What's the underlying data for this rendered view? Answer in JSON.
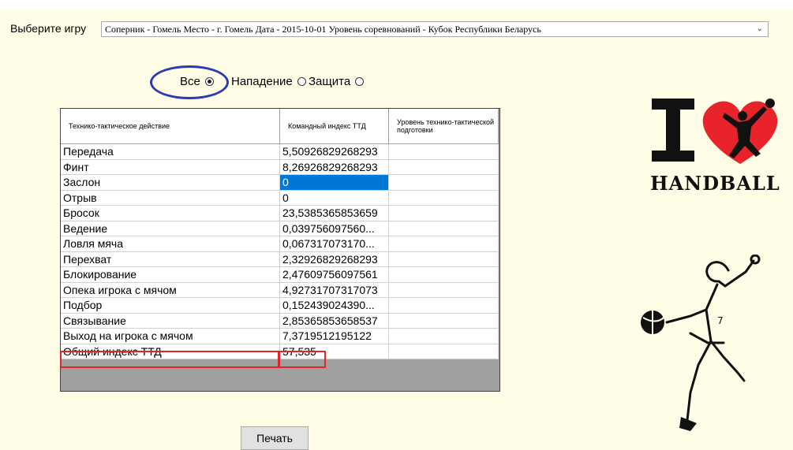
{
  "game_selector": {
    "label": "Выберите игру",
    "value": "Соперник - Гомель Место - г. Гомель Дата - 2015-10-01 Уровень соревнований - Кубок Республики Беларусь"
  },
  "filter": {
    "all_label": "Все",
    "attack_label": "Нападение",
    "defense_label": "Защита",
    "selected": "Все"
  },
  "table": {
    "headers": [
      "Технико-тактическое действие",
      "Командный индекс ТТД",
      "Уровень технико-тактической подготовки"
    ],
    "rows": [
      {
        "action": "Передача",
        "index": "5,50926829268293",
        "level": ""
      },
      {
        "action": "Финт",
        "index": "8,26926829268293",
        "level": ""
      },
      {
        "action": "Заслон",
        "index": "0",
        "level": ""
      },
      {
        "action": "Отрыв",
        "index": "0",
        "level": ""
      },
      {
        "action": "Бросок",
        "index": "23,5385365853659",
        "level": ""
      },
      {
        "action": "Ведение",
        "index": "0,039756097560...",
        "level": ""
      },
      {
        "action": "Ловля мяча",
        "index": "0,067317073170...",
        "level": ""
      },
      {
        "action": "Перехват",
        "index": "2,32926829268293",
        "level": ""
      },
      {
        "action": "Блокирование",
        "index": "2,47609756097561",
        "level": ""
      },
      {
        "action": "Опека игрока с мячом",
        "index": "4,92731707317073",
        "level": ""
      },
      {
        "action": "Подбор",
        "index": "0,152439024390...",
        "level": ""
      },
      {
        "action": "Связывание",
        "index": "2,85365853658537",
        "level": ""
      },
      {
        "action": "Выход на игрока с мячом",
        "index": "7,3719512195122",
        "level": ""
      },
      {
        "action": "Общий индекс ТТД",
        "index": "57,535",
        "level": ""
      }
    ],
    "selected_cell": {
      "row": 2,
      "column": "index"
    }
  },
  "print_button": {
    "label": "Печать"
  },
  "logo": {
    "text": "HANDBALL",
    "icon": "heart-icon"
  },
  "colors": {
    "background": "#fffde6",
    "selection": "#0078d7",
    "highlight_ellipse": "#2a3bb8",
    "highlight_box": "#e0262b",
    "heart": "#e8232a"
  }
}
